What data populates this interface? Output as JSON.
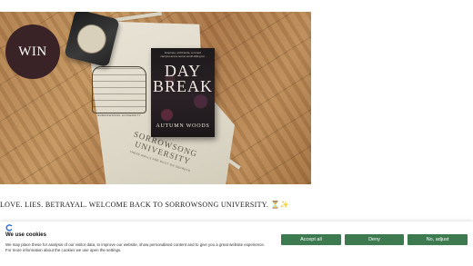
{
  "hero": {
    "badge": "WIN",
    "book": {
      "blurb": "Enemies, old friends, a ruined campus and a secret worth killing for.",
      "title_line1": "DAY",
      "title_line2": "BREAK",
      "author": "AUTUMN WOODS"
    },
    "tote": {
      "crest_caption": "SORROWSONG UNIVERSITY",
      "print_line1": "SORROWSONG",
      "print_line2": "UNIVERSITY",
      "print_motto": "THESE WALLS ARE BUILT ON SECRETS"
    }
  },
  "caption": {
    "text": "LOVE. LIES. BETRAYAL. WELCOME BACK TO SORROWSONG UNIVERSITY.",
    "emoji": "⏳✨"
  },
  "cookie_banner": {
    "logo": "cookie-provider-icon",
    "heading": "We use cookies",
    "body": "We may place these for analysis of our visitor data, to improve our website, show personalised content and to give you a great website experience. For more information about the cookies we use open the settings.",
    "accept_label": "Accept all",
    "deny_label": "Deny",
    "adjust_label": "No, adjust",
    "button_color": "#3d7a50"
  }
}
